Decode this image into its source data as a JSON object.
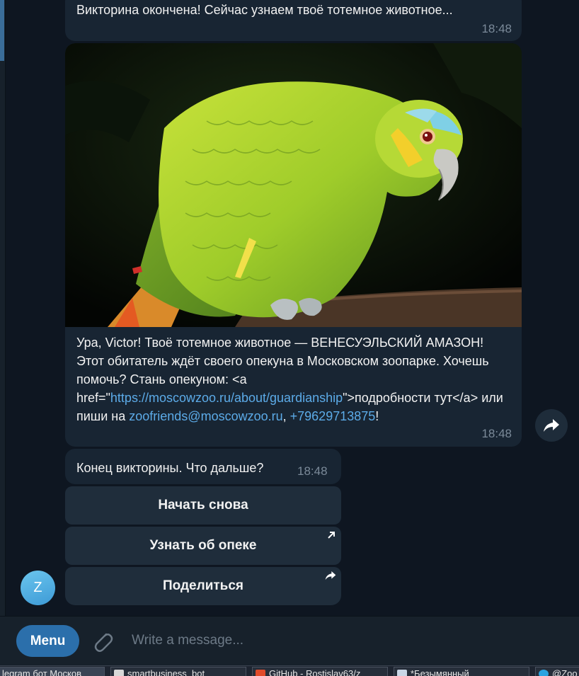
{
  "chat": {
    "messages": [
      {
        "text": "Викторина окончена! Сейчас узнаем твоё тотемное животное...",
        "time": "18:48"
      },
      {
        "has_photo": true,
        "text_before_link": "Ура, Victor! Твоё тотемное животное — ВЕНЕСУЭЛЬСКИЙ АМАЗОН! Этот обитатель ждёт своего опекуна в Московском зоопарке. Хочешь помочь? Стань опекуном: <a href=\"",
        "link_url": "https://moscowzoo.ru/about/guardianship",
        "text_after_link": "\">подробности тут</a> или пиши на ",
        "email": "zoofriends@moscowzoo.ru",
        "separator": ", ",
        "phone": "+79629713875",
        "tail": "!",
        "time": "18:48"
      },
      {
        "text": "Конец викторины. Что дальше?",
        "time": "18:48"
      }
    ],
    "keyboard": [
      {
        "label": "Начать снова",
        "icon": ""
      },
      {
        "label": "Узнать об опеке",
        "icon": "open-link-arrow-icon"
      },
      {
        "label": "Поделиться",
        "icon": "share-arrow-icon"
      }
    ],
    "avatar_letter": "Z"
  },
  "composer": {
    "menu_label": "Menu",
    "placeholder": "Write a message..."
  },
  "taskbar": {
    "items": [
      {
        "label": "legram бот Москов"
      },
      {
        "label": "smartbusiness_bot"
      },
      {
        "label": "GitHub - Rostislav63/z"
      },
      {
        "label": "*Безымянный"
      },
      {
        "label": "@Zoo"
      }
    ]
  },
  "colors": {
    "background": "#0e1621",
    "bubble": "#182533",
    "link": "#5cabe8",
    "menu_button": "#2b6fab",
    "keyboard_button": "#1f2d3b"
  }
}
